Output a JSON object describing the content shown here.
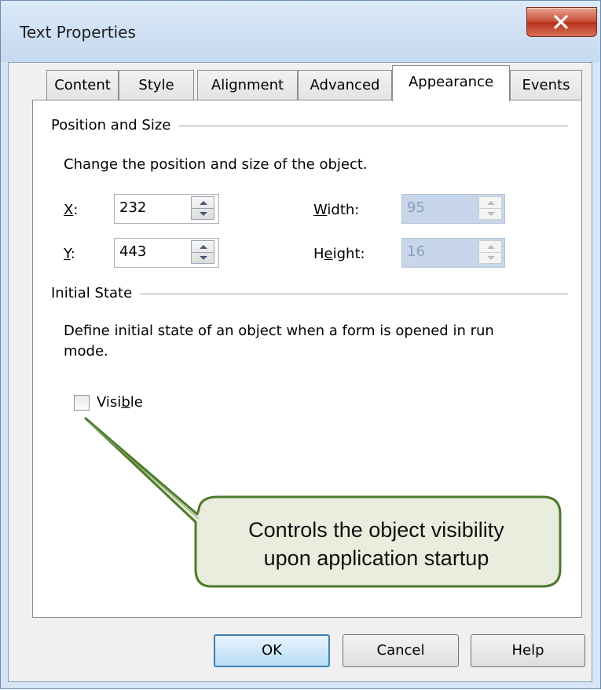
{
  "window": {
    "title": "Text Properties"
  },
  "tabs": [
    {
      "label": "Content"
    },
    {
      "label": "Style"
    },
    {
      "label": "Alignment"
    },
    {
      "label": "Advanced"
    },
    {
      "label": "Appearance",
      "active": true
    },
    {
      "label": "Events"
    }
  ],
  "position_size": {
    "group_label": "Position and Size",
    "description": "Change the position and size of the object.",
    "x": {
      "label_mnemonic": "X",
      "label_rest": ":",
      "value": "232"
    },
    "y": {
      "label_mnemonic": "Y",
      "label_rest": ":",
      "value": "443"
    },
    "width": {
      "label_mnemonic": "W",
      "label_rest": "idth:",
      "value": "95"
    },
    "height": {
      "label_pre": "H",
      "label_mnemonic": "e",
      "label_rest": "ight:",
      "value": "16"
    }
  },
  "initial_state": {
    "group_label": "Initial State",
    "description_line1": "Define initial state of an object when a form is opened in run",
    "description_line2": "mode.",
    "visible": {
      "label_pre": "Visi",
      "label_mnemonic": "b",
      "label_rest": "le",
      "checked": false
    }
  },
  "callout": {
    "line1": "Controls the object visibility",
    "line2": "upon application startup"
  },
  "buttons": {
    "ok": "OK",
    "cancel": "Cancel",
    "help": "Help"
  },
  "colors": {
    "callout_border": "#4e7a2a",
    "callout_fill": "#eef1e6",
    "disabled_field": "#c7d6ea"
  }
}
